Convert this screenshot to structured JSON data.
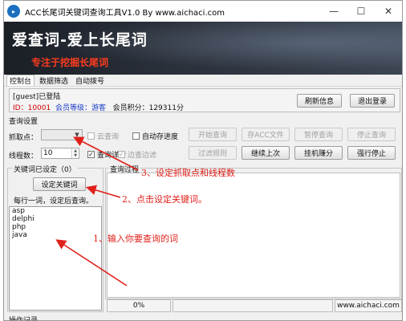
{
  "window": {
    "title": "ACC长尾词关键词查询工具V1.0  By  www.aichaci.com",
    "min": "—",
    "max": "☐",
    "close": "✕"
  },
  "banner": {
    "title": "爱查词-爱上长尾词",
    "slogan": "专注于挖掘长尾词"
  },
  "menu": [
    "控制台",
    "数据筛选",
    "自动拨号"
  ],
  "user": {
    "guest_line": "[guest]已登陆",
    "id_label": "ID：",
    "id_value": "10001",
    "level_label": "会员等级：",
    "level_value": "游客",
    "points_label": "会员积分：",
    "points_value": "129311分",
    "refresh_button": "刷新信息",
    "logout_button": "退出登录"
  },
  "query_settings": {
    "section": "查询设置",
    "grab_label": "抓取点：",
    "cloud_query": "云查询",
    "auto_save": "自动存进度",
    "start": "开始查询",
    "save_acc": "存ACC文件",
    "pause": "暂停查询",
    "stop": "停止查询",
    "threads_label": "线程数：",
    "threads_value": "10",
    "query_detail": "查询详情",
    "filter_while_query": "边查边滤",
    "filter_rules": "过滤规则",
    "continue_last": "继续上次",
    "hangup_earn": "挂机赚分",
    "force_stop": "强行停止"
  },
  "keywords": {
    "title": "关键词已设定（0）",
    "set_button": "设定关键词",
    "hint": "每行一词，设定后查询。",
    "items": [
      "asp",
      "delphi",
      "php",
      "java"
    ]
  },
  "process": {
    "title": "查询过程"
  },
  "status_bar": {
    "progress": "0%",
    "site": "www.aichaci.com",
    "bottom_partial": "操作记录"
  },
  "annotations": {
    "a1": "1、输入你要查询的词",
    "a2": "2、点击设定关键词。",
    "a3": "3、设定抓取点和线程数"
  },
  "colors": {
    "accent_red": "#e0201a",
    "link_blue": "#1a3cc8",
    "banner_dark": "#1b1f26"
  }
}
